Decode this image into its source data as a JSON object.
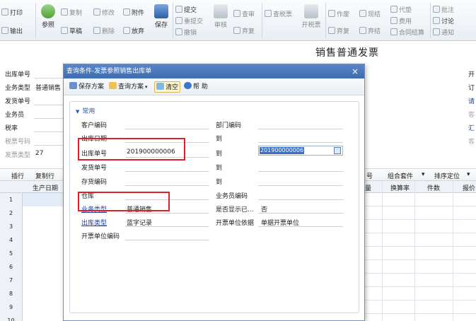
{
  "ribbon": {
    "print": "打印",
    "output": "输出",
    "ref": "参照",
    "copy": "复制",
    "draft": "草稿",
    "modify": "修改",
    "delete": "删除",
    "attach": "附件",
    "discard": "放弃",
    "save": "保存",
    "submit": "提交",
    "resubmit": "重提交",
    "withdraw": "撤销",
    "audit": "审核",
    "review": "查审",
    "unaudit": "弃复",
    "check_tax": "查税票",
    "issue_tax": "开税票",
    "void": "作废",
    "void_restore": "弃复",
    "cash": "现结",
    "cash_cancel": "弃结",
    "replace_sell": "代垫",
    "fee": "费用",
    "contract_settle": "合同结算",
    "annotate": "批注",
    "discuss": "讨论",
    "notify": "通知"
  },
  "page": {
    "title": "销售普通发票"
  },
  "form": {
    "out_no_label": "出库单号",
    "biz_type_label": "业务类型",
    "biz_type_value": "普通销售",
    "ship_no_label": "发货单号",
    "salesman_label": "业务员",
    "tax_rate_label": "税率",
    "tax_invoice_label": "税票号码",
    "invoice_type_label": "发票类型",
    "invoice_type_value": "27",
    "right_labels": [
      "开",
      "订",
      "请",
      "客",
      "汇",
      "客"
    ]
  },
  "grid": {
    "toolbar": {
      "insert": "插行",
      "copy_row": "复制行",
      "bom_no": "号",
      "combo": "组合套件",
      "sort": "排序定位"
    },
    "headers": {
      "prod_date": "生产日期",
      "qty": "量",
      "rate": "换算率",
      "pieces": "件数",
      "price": "报价"
    },
    "rows": [
      "1",
      "2",
      "3",
      "4",
      "5",
      "6",
      "7",
      "8",
      "9",
      "10"
    ]
  },
  "dialog": {
    "title": "查询条件-发票参照销售出库单",
    "close": "×",
    "toolbar": {
      "save_plan": "保存方案",
      "query_plan": "查询方案",
      "clear": "清空",
      "help": "帮 助"
    },
    "section": "常用",
    "fields": {
      "customer_code": "客户编码",
      "dept_code": "部门编码",
      "out_date": "出库日期",
      "to1": "到",
      "out_no": "出库单号",
      "out_no_from": "201900000006",
      "to2": "到",
      "out_no_to": "201900000006",
      "ship_no": "发货单号",
      "to3": "到",
      "stock_code": "存货编码",
      "to4": "到",
      "warehouse": "仓库",
      "salesman_code": "业务员编码",
      "biz_type": "业务类型",
      "biz_type_value": "普通销售",
      "show_done": "是否显示已...",
      "show_done_value": "否",
      "out_type": "出库类型",
      "out_type_value": "蓝字记录",
      "invoice_unit_basis": "开票单位依据",
      "invoice_unit_basis_value": "单据开票单位",
      "invoice_unit_code": "开票单位编码"
    }
  },
  "colors": {
    "dialog_title": "#3d6bb0",
    "highlight": "#e0202a",
    "selection": "#3a6fc6"
  }
}
